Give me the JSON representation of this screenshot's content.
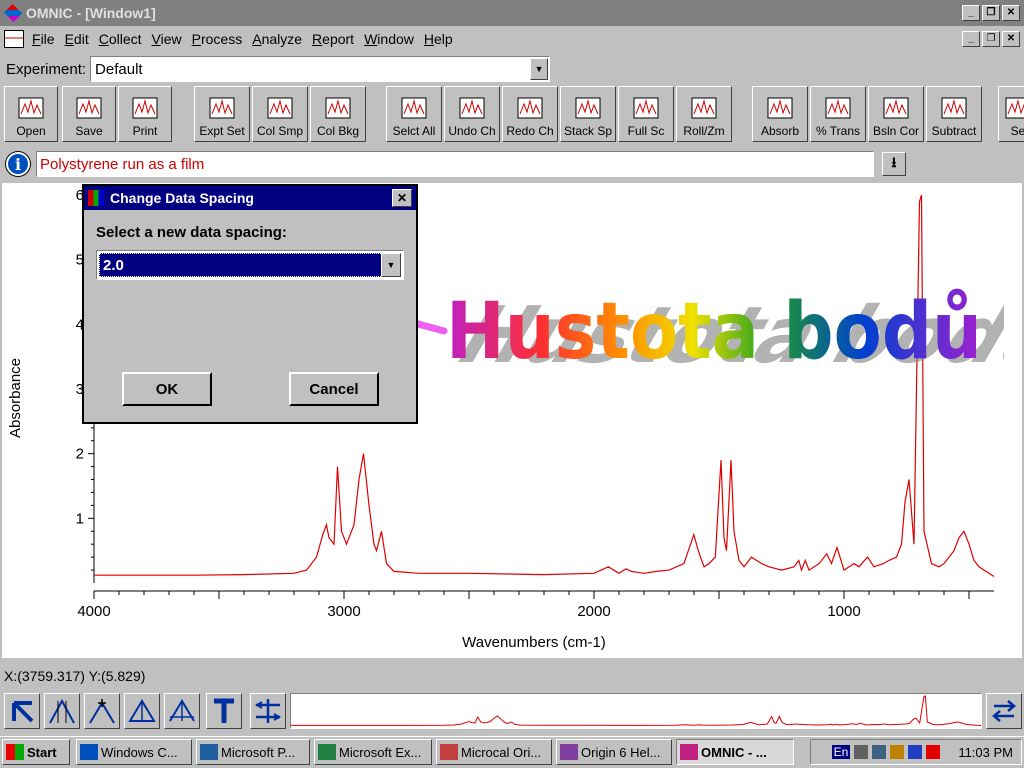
{
  "window": {
    "title": "OMNIC - [Window1]"
  },
  "menu": [
    "File",
    "Edit",
    "Collect",
    "View",
    "Process",
    "Analyze",
    "Report",
    "Window",
    "Help"
  ],
  "experiment": {
    "label": "Experiment:",
    "value": "Default"
  },
  "toolbar": [
    {
      "label": "Open",
      "icon": "folder-open-icon"
    },
    {
      "label": "Save",
      "icon": "floppy-icon"
    },
    {
      "label": "Print",
      "icon": "printer-icon"
    },
    {
      "label": "Expt Set",
      "icon": "experiment-setup-icon"
    },
    {
      "label": "Col Smp",
      "icon": "collect-sample-icon"
    },
    {
      "label": "Col Bkg",
      "icon": "collect-background-icon"
    },
    {
      "label": "Selct All",
      "icon": "select-all-icon"
    },
    {
      "label": "Undo Ch",
      "icon": "undo-change-icon"
    },
    {
      "label": "Redo Ch",
      "icon": "redo-change-icon"
    },
    {
      "label": "Stack Sp",
      "icon": "stack-spectra-icon"
    },
    {
      "label": "Full Sc",
      "icon": "full-scale-icon"
    },
    {
      "label": "Roll/Zm",
      "icon": "roll-zoom-icon"
    },
    {
      "label": "Absorb",
      "icon": "absorbance-icon"
    },
    {
      "label": "% Trans",
      "icon": "transmittance-icon"
    },
    {
      "label": "Bsln Cor",
      "icon": "baseline-correct-icon"
    },
    {
      "label": "Subtract",
      "icon": "subtract-icon"
    },
    {
      "label": "Se",
      "icon": "search-icon"
    }
  ],
  "info": {
    "text": "Polystyrene run as a film"
  },
  "chart_data": {
    "type": "line",
    "xlabel": "Wavenumbers (cm-1)",
    "ylabel": "Absorbance",
    "xlim": [
      4000,
      400
    ],
    "ylim": [
      0,
      6
    ],
    "xticks": [
      4000,
      3000,
      2000,
      1000
    ],
    "yticks": [
      1,
      2,
      3,
      4,
      5,
      6
    ],
    "series_color": "#e00000",
    "x": [
      4000,
      3600,
      3400,
      3200,
      3150,
      3110,
      3085,
      3070,
      3060,
      3040,
      3026,
      3010,
      2990,
      2960,
      2940,
      2922,
      2900,
      2880,
      2870,
      2850,
      2830,
      2800,
      2700,
      2500,
      2200,
      2000,
      1943,
      1900,
      1872,
      1850,
      1800,
      1750,
      1700,
      1640,
      1601,
      1583,
      1560,
      1540,
      1515,
      1492,
      1480,
      1470,
      1452,
      1440,
      1420,
      1400,
      1370,
      1330,
      1300,
      1250,
      1200,
      1181,
      1170,
      1155,
      1140,
      1100,
      1069,
      1050,
      1028,
      1000,
      960,
      940,
      906,
      880,
      842,
      820,
      790,
      770,
      756,
      740,
      720,
      698,
      690,
      680,
      650,
      620,
      600,
      560,
      540,
      520,
      500,
      480,
      460,
      440,
      420,
      400
    ],
    "y": [
      0.12,
      0.12,
      0.13,
      0.15,
      0.2,
      0.4,
      0.75,
      0.9,
      0.7,
      0.6,
      1.8,
      0.8,
      0.6,
      0.9,
      1.6,
      2.0,
      1.2,
      0.6,
      0.5,
      0.8,
      0.3,
      0.18,
      0.15,
      0.15,
      0.13,
      0.15,
      0.25,
      0.15,
      0.22,
      0.18,
      0.15,
      0.18,
      0.2,
      0.3,
      0.75,
      0.5,
      0.25,
      0.3,
      0.4,
      1.9,
      0.7,
      0.5,
      1.9,
      0.8,
      0.35,
      0.25,
      0.4,
      0.3,
      0.25,
      0.2,
      0.25,
      0.35,
      0.2,
      0.35,
      0.2,
      0.3,
      0.45,
      0.3,
      0.55,
      0.2,
      0.3,
      0.25,
      0.4,
      0.25,
      0.3,
      0.35,
      0.4,
      0.6,
      1.25,
      1.6,
      0.6,
      5.9,
      6.0,
      0.8,
      0.3,
      0.25,
      0.3,
      0.5,
      0.7,
      0.8,
      0.6,
      0.35,
      0.25,
      0.2,
      0.15,
      0.1
    ]
  },
  "dialog": {
    "title": "Change Data Spacing",
    "prompt": "Select a new data spacing:",
    "selected": "2.0",
    "ok": "OK",
    "cancel": "Cancel"
  },
  "annotation": {
    "text": "Hustota bodů",
    "arrow_color": "#f060f0"
  },
  "status": {
    "coords": "X:(3759.317)  Y:(5.829)"
  },
  "bottom_tools": [
    "pointer-icon",
    "region-icon",
    "peak-height-icon",
    "peak-area-icon",
    "corrected-area-icon",
    "text-tool-icon",
    "expand-icon"
  ],
  "taskbar": {
    "start": "Start",
    "tasks": [
      "Windows C...",
      "Microsoft P...",
      "Microsoft Ex...",
      "Microcal Ori...",
      "Origin 6 Hel...",
      "OMNIC - ..."
    ],
    "lang": "En",
    "clock": "11:03 PM"
  }
}
